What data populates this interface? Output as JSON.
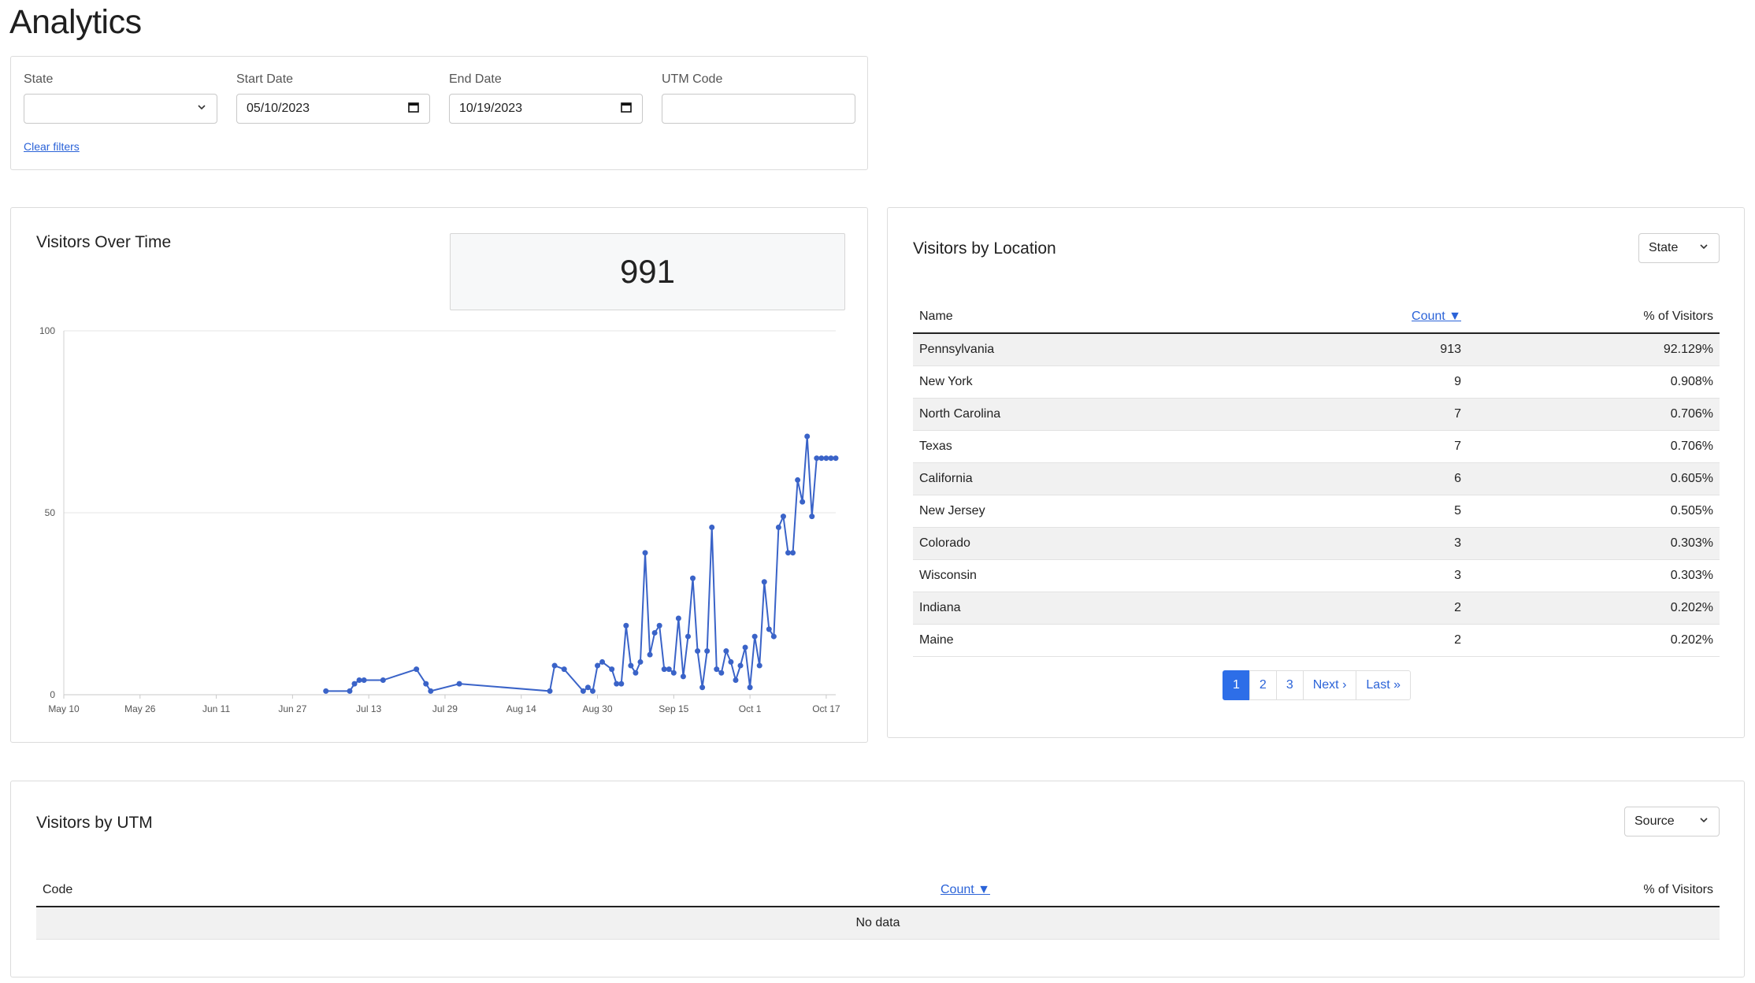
{
  "page": {
    "title": "Analytics"
  },
  "filters": {
    "state_label": "State",
    "state_value": "",
    "start_label": "Start Date",
    "start_value": "05/10/2023",
    "end_label": "End Date",
    "end_value": "10/19/2023",
    "utm_label": "UTM Code",
    "utm_value": "",
    "clear_label": "Clear filters"
  },
  "visitors_over_time": {
    "title": "Visitors Over Time",
    "total": "991"
  },
  "chart_data": {
    "type": "line",
    "title": "",
    "xlabel": "",
    "ylabel": "",
    "ylim": [
      0,
      100
    ],
    "yticks": [
      0,
      50,
      100
    ],
    "xlim": [
      "2023-05-10",
      "2023-10-19"
    ],
    "xticks": [
      "May 10",
      "May 26",
      "Jun 11",
      "Jun 27",
      "Jul 13",
      "Jul 29",
      "Aug 14",
      "Aug 30",
      "Sep 15",
      "Oct 1",
      "Oct 17"
    ],
    "grid": true,
    "color": "#3a63c8",
    "x": [
      "2023-07-04",
      "2023-07-09",
      "2023-07-10",
      "2023-07-11",
      "2023-07-12",
      "2023-07-16",
      "2023-07-23",
      "2023-07-25",
      "2023-07-26",
      "2023-08-01",
      "2023-08-20",
      "2023-08-21",
      "2023-08-23",
      "2023-08-27",
      "2023-08-28",
      "2023-08-29",
      "2023-08-30",
      "2023-08-31",
      "2023-09-02",
      "2023-09-03",
      "2023-09-04",
      "2023-09-05",
      "2023-09-06",
      "2023-09-07",
      "2023-09-08",
      "2023-09-09",
      "2023-09-10",
      "2023-09-11",
      "2023-09-12",
      "2023-09-13",
      "2023-09-14",
      "2023-09-15",
      "2023-09-16",
      "2023-09-17",
      "2023-09-18",
      "2023-09-19",
      "2023-09-20",
      "2023-09-21",
      "2023-09-22",
      "2023-09-23",
      "2023-09-24",
      "2023-09-25",
      "2023-09-26",
      "2023-09-27",
      "2023-09-28",
      "2023-09-29",
      "2023-09-30",
      "2023-10-01",
      "2023-10-02",
      "2023-10-03",
      "2023-10-04",
      "2023-10-05",
      "2023-10-06",
      "2023-10-07",
      "2023-10-08",
      "2023-10-09",
      "2023-10-10",
      "2023-10-11",
      "2023-10-12",
      "2023-10-13",
      "2023-10-14",
      "2023-10-15",
      "2023-10-16",
      "2023-10-17",
      "2023-10-18",
      "2023-10-19"
    ],
    "y": [
      1,
      1,
      3,
      4,
      4,
      4,
      7,
      3,
      1,
      3,
      1,
      8,
      7,
      1,
      2,
      1,
      8,
      9,
      7,
      3,
      3,
      19,
      8,
      6,
      9,
      39,
      11,
      17,
      19,
      7,
      7,
      6,
      21,
      5,
      16,
      32,
      12,
      2,
      12,
      46,
      7,
      6,
      12,
      9,
      4,
      8,
      13,
      2,
      16,
      8,
      31,
      18,
      16,
      46,
      49,
      39,
      39,
      59,
      53,
      71,
      49,
      65,
      65,
      65,
      65,
      65
    ]
  },
  "visitors_by_location": {
    "title": "Visitors by Location",
    "group_by": "State",
    "columns": {
      "name": "Name",
      "count": "Count ▼",
      "pct": "% of Visitors"
    },
    "rows": [
      {
        "name": "Pennsylvania",
        "count": "913",
        "pct": "92.129%"
      },
      {
        "name": "New York",
        "count": "9",
        "pct": "0.908%"
      },
      {
        "name": "North Carolina",
        "count": "7",
        "pct": "0.706%"
      },
      {
        "name": "Texas",
        "count": "7",
        "pct": "0.706%"
      },
      {
        "name": "California",
        "count": "6",
        "pct": "0.605%"
      },
      {
        "name": "New Jersey",
        "count": "5",
        "pct": "0.505%"
      },
      {
        "name": "Colorado",
        "count": "3",
        "pct": "0.303%"
      },
      {
        "name": "Wisconsin",
        "count": "3",
        "pct": "0.303%"
      },
      {
        "name": "Indiana",
        "count": "2",
        "pct": "0.202%"
      },
      {
        "name": "Maine",
        "count": "2",
        "pct": "0.202%"
      }
    ],
    "pagination": [
      "1",
      "2",
      "3",
      "Next ›",
      "Last »"
    ],
    "active_page": "1"
  },
  "visitors_by_utm": {
    "title": "Visitors by UTM",
    "group_by": "Source",
    "columns": {
      "code": "Code",
      "count": "Count ▼",
      "pct": "% of Visitors"
    },
    "empty": "No data"
  },
  "icons": {
    "dropdown": "chevron-down-icon",
    "calendar": "calendar-icon"
  }
}
